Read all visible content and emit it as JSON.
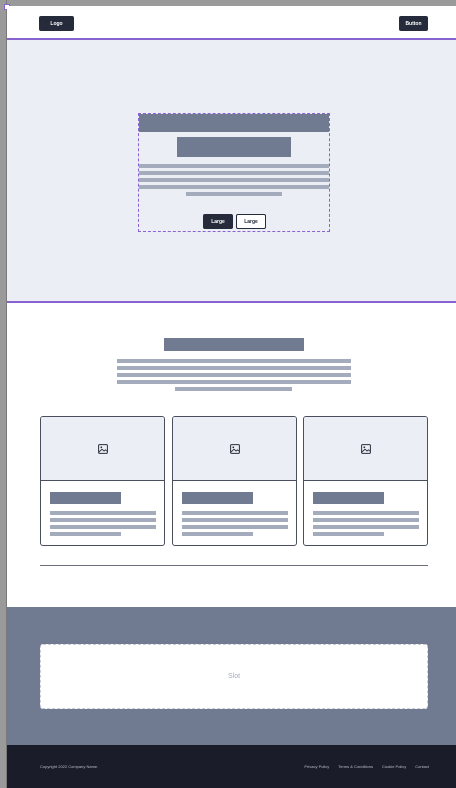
{
  "header": {
    "logo_label": "Logo",
    "button_label": "Button"
  },
  "hero": {
    "primary_button": "Large",
    "secondary_button": "Large"
  },
  "features": {
    "cards": [
      {
        "icon": "image-icon"
      },
      {
        "icon": "image-icon"
      },
      {
        "icon": "image-icon"
      }
    ]
  },
  "slot": {
    "label": "Slot"
  },
  "footer": {
    "copyright": "Copyright 2022 Company Name.",
    "links": [
      "Privacy Policy",
      "Terms & Conditions",
      "Cookie Policy",
      "Contact"
    ]
  },
  "colors": {
    "accent_outline": "#8a63d2",
    "dark": "#252b3b",
    "placeholder": "#707a91",
    "placeholder_light": "#a3abbd",
    "hero_bg": "#eceef6",
    "footer_bg": "#1a1d29"
  }
}
